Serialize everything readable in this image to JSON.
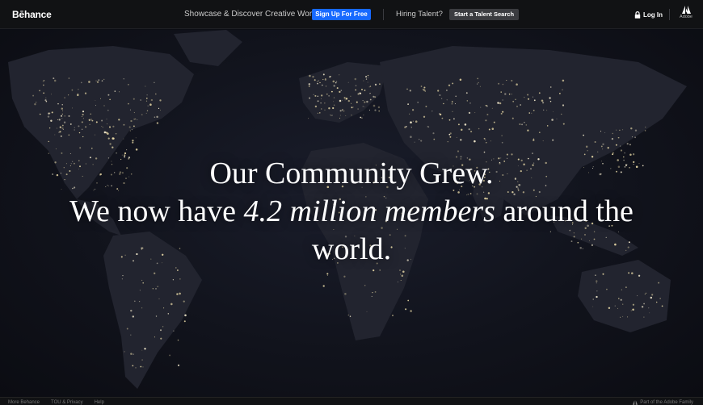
{
  "header": {
    "logo": "Bēhance",
    "tagline": "Showcase & Discover Creative Work",
    "signup_label": "Sign Up For Free",
    "hiring_text": "Hiring Talent?",
    "talent_search_label": "Start a Talent Search",
    "login_label": "Log In",
    "login_icon": "lock-icon",
    "adobe_label": "Adobe",
    "adobe_icon": "adobe-logo-icon"
  },
  "hero": {
    "line1": "Our Community Grew.",
    "line2_start": "We now have ",
    "line2_emphasis": "4.2 million members",
    "line2_end": " around the world.",
    "background": "world-map-night-lights",
    "accent_color": "#1769ff"
  },
  "footer": {
    "links": [
      "More Behance",
      "TOU & Privacy",
      "Help"
    ],
    "family_label": "Part of the Adobe Family",
    "family_icon": "adobe-logo-icon"
  }
}
